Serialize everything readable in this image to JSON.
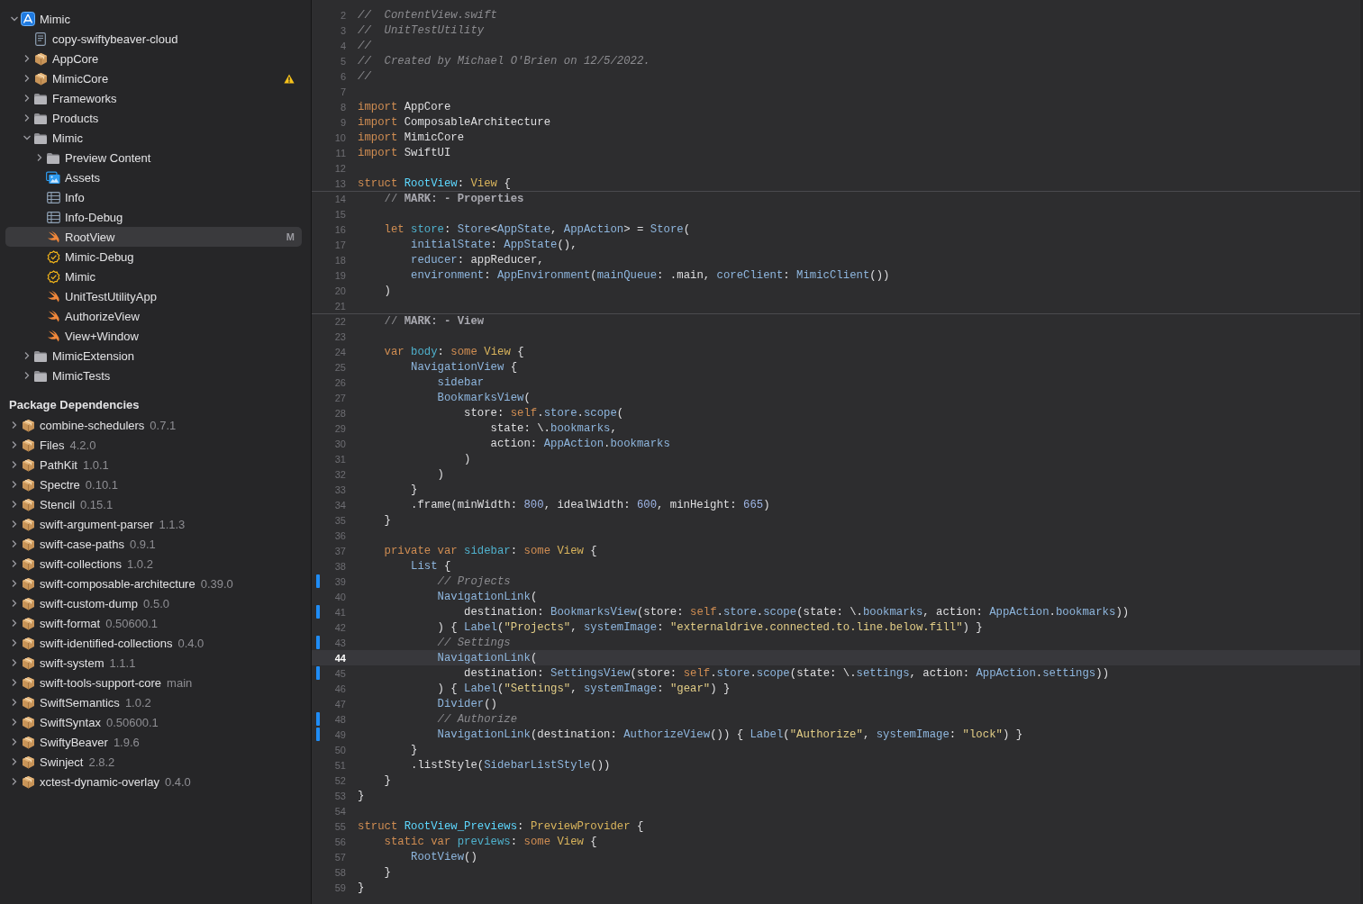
{
  "navigator": {
    "items": [
      {
        "name": "Mimic",
        "kind": "project",
        "expanded": true,
        "selected": false,
        "children": [
          {
            "name": "copy-swiftybeaver-cloud",
            "kind": "file",
            "selected": false
          },
          {
            "name": "AppCore",
            "kind": "package",
            "expanded": false,
            "selected": false
          },
          {
            "name": "MimicCore",
            "kind": "package",
            "expanded": false,
            "selected": false,
            "warning": true
          },
          {
            "name": "Frameworks",
            "kind": "folder",
            "expanded": false,
            "selected": false
          },
          {
            "name": "Products",
            "kind": "folder",
            "expanded": false,
            "selected": false
          },
          {
            "name": "Mimic",
            "kind": "folder",
            "expanded": true,
            "selected": false,
            "children": [
              {
                "name": "Preview Content",
                "kind": "folder",
                "expanded": false,
                "selected": false
              },
              {
                "name": "Assets",
                "kind": "assets",
                "selected": false
              },
              {
                "name": "Info",
                "kind": "plist",
                "selected": false
              },
              {
                "name": "Info-Debug",
                "kind": "plist",
                "selected": false
              },
              {
                "name": "RootView",
                "kind": "swift",
                "selected": true,
                "badge": "M"
              },
              {
                "name": "Mimic-Debug",
                "kind": "entitlements",
                "selected": false
              },
              {
                "name": "Mimic",
                "kind": "entitlements",
                "selected": false
              },
              {
                "name": "UnitTestUtilityApp",
                "kind": "swift",
                "selected": false
              },
              {
                "name": "AuthorizeView",
                "kind": "swift",
                "selected": false
              },
              {
                "name": "View+Window",
                "kind": "swift",
                "selected": false
              }
            ]
          },
          {
            "name": "MimicExtension",
            "kind": "folder",
            "expanded": false,
            "selected": false
          },
          {
            "name": "MimicTests",
            "kind": "folder",
            "expanded": false,
            "selected": false
          }
        ]
      }
    ]
  },
  "package_dependencies": {
    "title": "Package Dependencies",
    "packages": [
      {
        "name": "combine-schedulers",
        "version": "0.7.1",
        "expanded": false
      },
      {
        "name": "Files",
        "version": "4.2.0",
        "expanded": false
      },
      {
        "name": "PathKit",
        "version": "1.0.1",
        "expanded": false
      },
      {
        "name": "Spectre",
        "version": "0.10.1",
        "expanded": false
      },
      {
        "name": "Stencil",
        "version": "0.15.1",
        "expanded": false
      },
      {
        "name": "swift-argument-parser",
        "version": "1.1.3",
        "expanded": false
      },
      {
        "name": "swift-case-paths",
        "version": "0.9.1",
        "expanded": false
      },
      {
        "name": "swift-collections",
        "version": "1.0.2",
        "expanded": false
      },
      {
        "name": "swift-composable-architecture",
        "version": "0.39.0",
        "expanded": false
      },
      {
        "name": "swift-custom-dump",
        "version": "0.5.0",
        "expanded": false
      },
      {
        "name": "swift-format",
        "version": "0.50600.1",
        "expanded": false
      },
      {
        "name": "swift-identified-collections",
        "version": "0.4.0",
        "expanded": false
      },
      {
        "name": "swift-system",
        "version": "1.1.1",
        "expanded": false
      },
      {
        "name": "swift-tools-support-core",
        "version": "main",
        "expanded": false
      },
      {
        "name": "SwiftSemantics",
        "version": "1.0.2",
        "expanded": false
      },
      {
        "name": "SwiftSyntax",
        "version": "0.50600.1",
        "expanded": false
      },
      {
        "name": "SwiftyBeaver",
        "version": "1.9.6",
        "expanded": false
      },
      {
        "name": "Swinject",
        "version": "2.8.2",
        "expanded": false
      },
      {
        "name": "xctest-dynamic-overlay",
        "version": "0.4.0",
        "expanded": false
      }
    ]
  },
  "editor": {
    "lines": [
      {
        "number": "2",
        "changed": false,
        "current": false,
        "tokens": [
          {
            "kind": "comment",
            "text": "//  ContentView.swift"
          }
        ]
      },
      {
        "number": "3",
        "changed": false,
        "current": false,
        "tokens": [
          {
            "kind": "comment",
            "text": "//  UnitTestUtility"
          }
        ]
      },
      {
        "number": "4",
        "changed": false,
        "current": false,
        "tokens": [
          {
            "kind": "comment",
            "text": "//"
          }
        ]
      },
      {
        "number": "5",
        "changed": false,
        "current": false,
        "tokens": [
          {
            "kind": "comment",
            "text": "//  Created by Michael O'Brien on 12/5/2022."
          }
        ]
      },
      {
        "number": "6",
        "changed": false,
        "current": false,
        "tokens": [
          {
            "kind": "comment",
            "text": "//"
          }
        ]
      },
      {
        "number": "7",
        "changed": false,
        "current": false
      },
      {
        "number": "8",
        "changed": false,
        "current": false,
        "tokens": [
          {
            "kind": "keyword",
            "text": "import"
          },
          {
            "kind": "plain",
            "text": " AppCore"
          }
        ]
      },
      {
        "number": "9",
        "changed": false,
        "current": false,
        "tokens": [
          {
            "kind": "keyword",
            "text": "import"
          },
          {
            "kind": "plain",
            "text": " ComposableArchitecture"
          }
        ]
      },
      {
        "number": "10",
        "changed": false,
        "current": false,
        "tokens": [
          {
            "kind": "keyword",
            "text": "import"
          },
          {
            "kind": "plain",
            "text": " MimicCore"
          }
        ]
      },
      {
        "number": "11",
        "changed": false,
        "current": false,
        "tokens": [
          {
            "kind": "keyword",
            "text": "import"
          },
          {
            "kind": "plain",
            "text": " SwiftUI"
          }
        ]
      },
      {
        "number": "12",
        "changed": false,
        "current": false
      },
      {
        "number": "13",
        "changed": false,
        "current": false,
        "tokens": [
          {
            "kind": "keyword",
            "text": "struct "
          },
          {
            "kind": "decl",
            "text": "RootView"
          },
          {
            "kind": "plain",
            "text": ": "
          },
          {
            "kind": "system",
            "text": "View"
          },
          {
            "kind": "plain",
            "text": " {"
          }
        ]
      },
      {
        "number": "14",
        "changed": false,
        "current": false,
        "tokens": [
          {
            "kind": "marker",
            "text": "    // "
          },
          {
            "kind": "mark",
            "text": "MARK: - Properties"
          }
        ]
      },
      {
        "number": "15",
        "changed": false,
        "current": false
      },
      {
        "number": "16",
        "changed": false,
        "current": false,
        "tokens": [
          {
            "kind": "keyword",
            "text": "    let "
          },
          {
            "kind": "member",
            "text": "store"
          },
          {
            "kind": "plain",
            "text": ": "
          },
          {
            "kind": "type",
            "text": "Store"
          },
          {
            "kind": "plain",
            "text": "<"
          },
          {
            "kind": "type",
            "text": "AppState"
          },
          {
            "kind": "plain",
            "text": ", "
          },
          {
            "kind": "type",
            "text": "AppAction"
          },
          {
            "kind": "plain",
            "text": "> = "
          },
          {
            "kind": "type",
            "text": "Store"
          },
          {
            "kind": "plain",
            "text": "("
          }
        ]
      },
      {
        "number": "17",
        "changed": false,
        "current": false,
        "tokens": [
          {
            "kind": "type",
            "text": "        initialState"
          },
          {
            "kind": "plain",
            "text": ": "
          },
          {
            "kind": "type",
            "text": "AppState"
          },
          {
            "kind": "plain",
            "text": "(),"
          }
        ]
      },
      {
        "number": "18",
        "changed": false,
        "current": false,
        "tokens": [
          {
            "kind": "type",
            "text": "        reducer"
          },
          {
            "kind": "plain",
            "text": ": appReducer,"
          }
        ]
      },
      {
        "number": "19",
        "changed": false,
        "current": false,
        "tokens": [
          {
            "kind": "type",
            "text": "        environment"
          },
          {
            "kind": "plain",
            "text": ": "
          },
          {
            "kind": "type",
            "text": "AppEnvironment"
          },
          {
            "kind": "plain",
            "text": "("
          },
          {
            "kind": "type",
            "text": "mainQueue"
          },
          {
            "kind": "plain",
            "text": ": .main, "
          },
          {
            "kind": "type",
            "text": "coreClient"
          },
          {
            "kind": "plain",
            "text": ": "
          },
          {
            "kind": "type",
            "text": "MimicClient"
          },
          {
            "kind": "plain",
            "text": "())"
          }
        ]
      },
      {
        "number": "20",
        "changed": false,
        "current": false,
        "tokens": [
          {
            "kind": "plain",
            "text": "    )"
          }
        ]
      },
      {
        "number": "21",
        "changed": false,
        "current": false
      },
      {
        "number": "22",
        "changed": false,
        "current": false,
        "tokens": [
          {
            "kind": "marker",
            "text": "    // "
          },
          {
            "kind": "mark",
            "text": "MARK: - View"
          }
        ]
      },
      {
        "number": "23",
        "changed": false,
        "current": false
      },
      {
        "number": "24",
        "changed": false,
        "current": false,
        "tokens": [
          {
            "kind": "keyword",
            "text": "    var "
          },
          {
            "kind": "member",
            "text": "body"
          },
          {
            "kind": "plain",
            "text": ": "
          },
          {
            "kind": "keyword",
            "text": "some "
          },
          {
            "kind": "system",
            "text": "View"
          },
          {
            "kind": "plain",
            "text": " {"
          }
        ]
      },
      {
        "number": "25",
        "changed": false,
        "current": false,
        "tokens": [
          {
            "kind": "type",
            "text": "        NavigationView"
          },
          {
            "kind": "plain",
            "text": " {"
          }
        ]
      },
      {
        "number": "26",
        "changed": false,
        "current": false,
        "tokens": [
          {
            "kind": "type",
            "text": "            sidebar"
          }
        ]
      },
      {
        "number": "27",
        "changed": false,
        "current": false,
        "tokens": [
          {
            "kind": "type",
            "text": "            BookmarksView"
          },
          {
            "kind": "plain",
            "text": "("
          }
        ]
      },
      {
        "number": "28",
        "changed": false,
        "current": false,
        "tokens": [
          {
            "kind": "plain",
            "text": "                store: "
          },
          {
            "kind": "keyword",
            "text": "self"
          },
          {
            "kind": "plain",
            "text": "."
          },
          {
            "kind": "type",
            "text": "store"
          },
          {
            "kind": "plain",
            "text": "."
          },
          {
            "kind": "type",
            "text": "scope"
          },
          {
            "kind": "plain",
            "text": "("
          }
        ]
      },
      {
        "number": "29",
        "changed": false,
        "current": false,
        "tokens": [
          {
            "kind": "plain",
            "text": "                    state: \\."
          },
          {
            "kind": "type",
            "text": "bookmarks"
          },
          {
            "kind": "plain",
            "text": ","
          }
        ]
      },
      {
        "number": "30",
        "changed": false,
        "current": false,
        "tokens": [
          {
            "kind": "plain",
            "text": "                    action: "
          },
          {
            "kind": "type",
            "text": "AppAction"
          },
          {
            "kind": "plain",
            "text": "."
          },
          {
            "kind": "type",
            "text": "bookmarks"
          }
        ]
      },
      {
        "number": "31",
        "changed": false,
        "current": false,
        "tokens": [
          {
            "kind": "plain",
            "text": "                )"
          }
        ]
      },
      {
        "number": "32",
        "changed": false,
        "current": false,
        "tokens": [
          {
            "kind": "plain",
            "text": "            )"
          }
        ]
      },
      {
        "number": "33",
        "changed": false,
        "current": false,
        "tokens": [
          {
            "kind": "plain",
            "text": "        }"
          }
        ]
      },
      {
        "number": "34",
        "changed": false,
        "current": false,
        "tokens": [
          {
            "kind": "plain",
            "text": "        .frame(minWidth: "
          },
          {
            "kind": "number",
            "text": "800"
          },
          {
            "kind": "plain",
            "text": ", idealWidth: "
          },
          {
            "kind": "number",
            "text": "600"
          },
          {
            "kind": "plain",
            "text": ", minHeight: "
          },
          {
            "kind": "number",
            "text": "665"
          },
          {
            "kind": "plain",
            "text": ")"
          }
        ]
      },
      {
        "number": "35",
        "changed": false,
        "current": false,
        "tokens": [
          {
            "kind": "plain",
            "text": "    }"
          }
        ]
      },
      {
        "number": "36",
        "changed": false,
        "current": false
      },
      {
        "number": "37",
        "changed": false,
        "current": false,
        "tokens": [
          {
            "kind": "keyword",
            "text": "    private var "
          },
          {
            "kind": "member",
            "text": "sidebar"
          },
          {
            "kind": "plain",
            "text": ": "
          },
          {
            "kind": "keyword",
            "text": "some "
          },
          {
            "kind": "system",
            "text": "View"
          },
          {
            "kind": "plain",
            "text": " {"
          }
        ]
      },
      {
        "number": "38",
        "changed": false,
        "current": false,
        "tokens": [
          {
            "kind": "type",
            "text": "        List"
          },
          {
            "kind": "plain",
            "text": " {"
          }
        ]
      },
      {
        "number": "39",
        "changed": true,
        "current": false,
        "tokens": [
          {
            "kind": "comment",
            "text": "            // Projects"
          }
        ]
      },
      {
        "number": "40",
        "changed": false,
        "current": false,
        "tokens": [
          {
            "kind": "type",
            "text": "            NavigationLink"
          },
          {
            "kind": "plain",
            "text": "("
          }
        ]
      },
      {
        "number": "41",
        "changed": true,
        "current": false,
        "tokens": [
          {
            "kind": "plain",
            "text": "                destination: "
          },
          {
            "kind": "type",
            "text": "BookmarksView"
          },
          {
            "kind": "plain",
            "text": "(store: "
          },
          {
            "kind": "keyword",
            "text": "self"
          },
          {
            "kind": "plain",
            "text": "."
          },
          {
            "kind": "type",
            "text": "store"
          },
          {
            "kind": "plain",
            "text": "."
          },
          {
            "kind": "type",
            "text": "scope"
          },
          {
            "kind": "plain",
            "text": "(state: \\."
          },
          {
            "kind": "type",
            "text": "bookmarks"
          },
          {
            "kind": "plain",
            "text": ", action: "
          },
          {
            "kind": "type",
            "text": "AppAction"
          },
          {
            "kind": "plain",
            "text": "."
          },
          {
            "kind": "type",
            "text": "bookmarks"
          },
          {
            "kind": "plain",
            "text": "))"
          }
        ]
      },
      {
        "number": "42",
        "changed": false,
        "current": false,
        "tokens": [
          {
            "kind": "plain",
            "text": "            ) { "
          },
          {
            "kind": "type",
            "text": "Label"
          },
          {
            "kind": "plain",
            "text": "("
          },
          {
            "kind": "string",
            "text": "\"Projects\""
          },
          {
            "kind": "plain",
            "text": ", "
          },
          {
            "kind": "type",
            "text": "systemImage"
          },
          {
            "kind": "plain",
            "text": ": "
          },
          {
            "kind": "string",
            "text": "\"externaldrive.connected.to.line.below.fill\""
          },
          {
            "kind": "plain",
            "text": ") }"
          }
        ]
      },
      {
        "number": "43",
        "changed": true,
        "current": false,
        "tokens": [
          {
            "kind": "comment",
            "text": "            // Settings"
          }
        ]
      },
      {
        "number": "44",
        "changed": false,
        "current": true,
        "tokens": [
          {
            "kind": "type",
            "text": "            NavigationLink"
          },
          {
            "kind": "plain",
            "text": "("
          }
        ]
      },
      {
        "number": "45",
        "changed": true,
        "current": false,
        "tokens": [
          {
            "kind": "plain",
            "text": "                destination: "
          },
          {
            "kind": "type",
            "text": "SettingsView"
          },
          {
            "kind": "plain",
            "text": "(store: "
          },
          {
            "kind": "keyword",
            "text": "self"
          },
          {
            "kind": "plain",
            "text": "."
          },
          {
            "kind": "type",
            "text": "store"
          },
          {
            "kind": "plain",
            "text": "."
          },
          {
            "kind": "type",
            "text": "scope"
          },
          {
            "kind": "plain",
            "text": "(state: \\."
          },
          {
            "kind": "type",
            "text": "settings"
          },
          {
            "kind": "plain",
            "text": ", action: "
          },
          {
            "kind": "type",
            "text": "AppAction"
          },
          {
            "kind": "plain",
            "text": "."
          },
          {
            "kind": "type",
            "text": "settings"
          },
          {
            "kind": "plain",
            "text": "))"
          }
        ]
      },
      {
        "number": "46",
        "changed": false,
        "current": false,
        "tokens": [
          {
            "kind": "plain",
            "text": "            ) { "
          },
          {
            "kind": "type",
            "text": "Label"
          },
          {
            "kind": "plain",
            "text": "("
          },
          {
            "kind": "string",
            "text": "\"Settings\""
          },
          {
            "kind": "plain",
            "text": ", "
          },
          {
            "kind": "type",
            "text": "systemImage"
          },
          {
            "kind": "plain",
            "text": ": "
          },
          {
            "kind": "string",
            "text": "\"gear\""
          },
          {
            "kind": "plain",
            "text": ") }"
          }
        ]
      },
      {
        "number": "47",
        "changed": false,
        "current": false,
        "tokens": [
          {
            "kind": "type",
            "text": "            Divider"
          },
          {
            "kind": "plain",
            "text": "()"
          }
        ]
      },
      {
        "number": "48",
        "changed": true,
        "current": false,
        "tokens": [
          {
            "kind": "comment",
            "text": "            // Authorize"
          }
        ]
      },
      {
        "number": "49",
        "changed": true,
        "current": false,
        "tokens": [
          {
            "kind": "type",
            "text": "            NavigationLink"
          },
          {
            "kind": "plain",
            "text": "(destination: "
          },
          {
            "kind": "type",
            "text": "AuthorizeView"
          },
          {
            "kind": "plain",
            "text": "()) { "
          },
          {
            "kind": "type",
            "text": "Label"
          },
          {
            "kind": "plain",
            "text": "("
          },
          {
            "kind": "string",
            "text": "\"Authorize\""
          },
          {
            "kind": "plain",
            "text": ", "
          },
          {
            "kind": "type",
            "text": "systemImage"
          },
          {
            "kind": "plain",
            "text": ": "
          },
          {
            "kind": "string",
            "text": "\"lock\""
          },
          {
            "kind": "plain",
            "text": ") }"
          }
        ]
      },
      {
        "number": "50",
        "changed": false,
        "current": false,
        "tokens": [
          {
            "kind": "plain",
            "text": "        }"
          }
        ]
      },
      {
        "number": "51",
        "changed": false,
        "current": false,
        "tokens": [
          {
            "kind": "plain",
            "text": "        .listStyle("
          },
          {
            "kind": "type",
            "text": "SidebarListStyle"
          },
          {
            "kind": "plain",
            "text": "())"
          }
        ]
      },
      {
        "number": "52",
        "changed": false,
        "current": false,
        "tokens": [
          {
            "kind": "plain",
            "text": "    }"
          }
        ]
      },
      {
        "number": "53",
        "changed": false,
        "current": false,
        "tokens": [
          {
            "kind": "plain",
            "text": "}"
          }
        ]
      },
      {
        "number": "54",
        "changed": false,
        "current": false
      },
      {
        "number": "55",
        "changed": false,
        "current": false,
        "tokens": [
          {
            "kind": "keyword",
            "text": "struct "
          },
          {
            "kind": "decl",
            "text": "RootView_Previews"
          },
          {
            "kind": "plain",
            "text": ": "
          },
          {
            "kind": "system",
            "text": "PreviewProvider"
          },
          {
            "kind": "plain",
            "text": " {"
          }
        ]
      },
      {
        "number": "56",
        "changed": false,
        "current": false,
        "tokens": [
          {
            "kind": "keyword",
            "text": "    static var "
          },
          {
            "kind": "member",
            "text": "previews"
          },
          {
            "kind": "plain",
            "text": ": "
          },
          {
            "kind": "keyword",
            "text": "some "
          },
          {
            "kind": "system",
            "text": "View"
          },
          {
            "kind": "plain",
            "text": " {"
          }
        ]
      },
      {
        "number": "57",
        "changed": false,
        "current": false,
        "tokens": [
          {
            "kind": "type",
            "text": "        RootView"
          },
          {
            "kind": "plain",
            "text": "()"
          }
        ]
      },
      {
        "number": "58",
        "changed": false,
        "current": false,
        "tokens": [
          {
            "kind": "plain",
            "text": "    }"
          }
        ]
      },
      {
        "number": "59",
        "changed": false,
        "current": false,
        "tokens": [
          {
            "kind": "plain",
            "text": "}"
          }
        ]
      }
    ]
  }
}
